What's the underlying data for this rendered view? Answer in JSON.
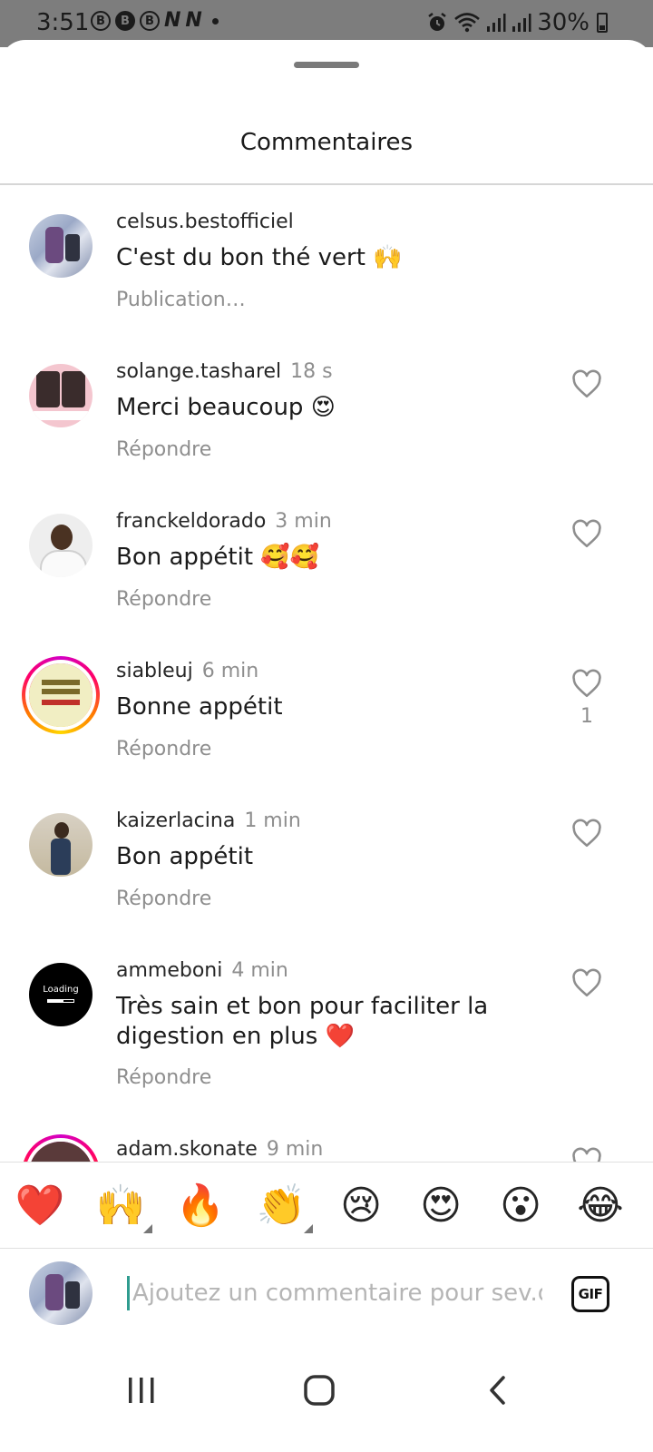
{
  "status_bar": {
    "time": "3:51",
    "notif_icons": [
      "B",
      "B",
      "B"
    ],
    "notif_n": [
      "N",
      "N"
    ],
    "dot": "•",
    "battery": "30%"
  },
  "sheet": {
    "title": "Commentaires"
  },
  "comments": [
    {
      "username": "celsus.bestofficiel",
      "time": "",
      "text": "C'est du bon thé vert 🙌",
      "action": "Publication…",
      "likes": ""
    },
    {
      "username": "solange.tasharel",
      "time": "18 s",
      "text": "Merci beaucoup 😍",
      "action": "Répondre",
      "likes": ""
    },
    {
      "username": "franckeldorado",
      "time": "3 min",
      "text": "Bon appétit 🥰🥰",
      "action": "Répondre",
      "likes": ""
    },
    {
      "username": "siableuj",
      "time": "6 min",
      "text": "Bonne appétit",
      "action": "Répondre",
      "likes": "1"
    },
    {
      "username": "kaizerlacina",
      "time": "1 min",
      "text": "Bon appétit",
      "action": "Répondre",
      "likes": ""
    },
    {
      "username": "ammeboni",
      "time": "4 min",
      "text": "Très sain et bon pour faciliter la digestion en plus ❤️",
      "action": "Répondre",
      "likes": ""
    },
    {
      "username": "adam.skonate",
      "time": "9 min",
      "text": "",
      "action": "",
      "likes": ""
    }
  ],
  "avatar_text": {
    "loading": "Loading"
  },
  "emoji_bar": [
    "❤️",
    "🙌",
    "🔥",
    "👏",
    "😢",
    "😍",
    "😮",
    "😂"
  ],
  "input": {
    "placeholder": "Ajoutez un commentaire pour sev.diet",
    "gif_label": "GIF"
  },
  "colors": {
    "status_bar_bg": "#7d7d7d",
    "secondary_text": "#8e8e8e",
    "cursor": "#2f9c8f"
  }
}
